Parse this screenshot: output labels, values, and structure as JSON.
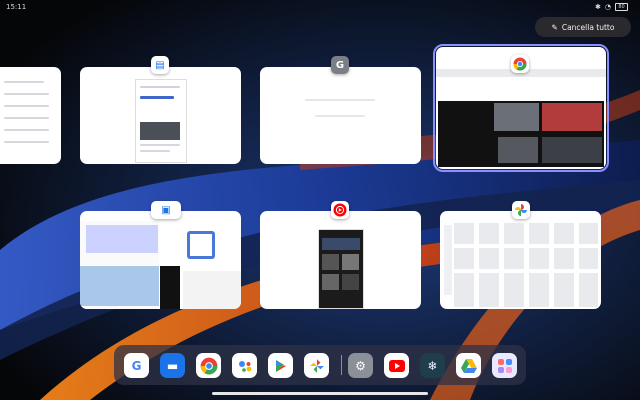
{
  "status_bar": {
    "time": "15:11",
    "battery": "80",
    "icons": [
      "bluetooth-icon",
      "wifi-icon",
      "battery-icon"
    ]
  },
  "clear_all": {
    "label": "Cancella tutto",
    "icon": "broom-icon"
  },
  "recent_apps": [
    {
      "id": "left-partial",
      "icon": "settings-list"
    },
    {
      "id": "app-2",
      "icon": "news-app-icon"
    },
    {
      "id": "app-3",
      "icon": "google-app-icon"
    },
    {
      "id": "chrome",
      "icon": "chrome-icon",
      "selected": true
    },
    {
      "id": "split-view",
      "icon": "split-screen-icon"
    },
    {
      "id": "youtube-music",
      "icon": "youtube-music-icon"
    },
    {
      "id": "photos",
      "icon": "google-photos-icon"
    }
  ],
  "dock": {
    "apps": [
      "google-icon",
      "messages-icon",
      "chrome-icon",
      "assistant-icon",
      "play-store-icon",
      "photos-icon",
      "settings-icon",
      "youtube-icon",
      "snowflake-icon",
      "drive-icon",
      "app-library-icon"
    ]
  },
  "colors": {
    "accent_outline": "#8a90ff",
    "dock_bg": "#2d3246"
  }
}
